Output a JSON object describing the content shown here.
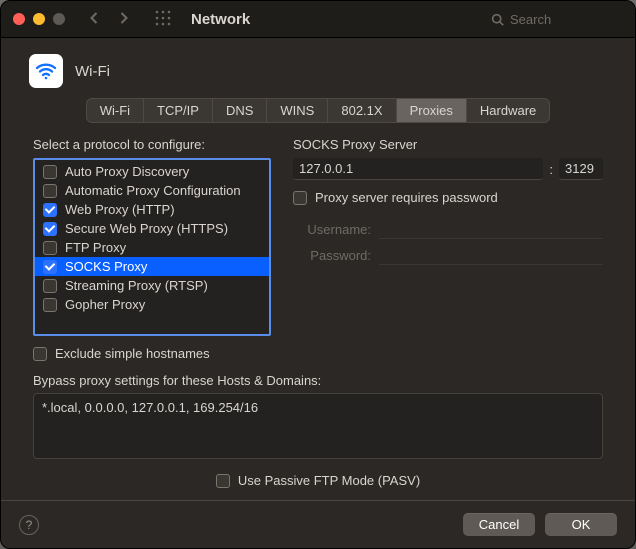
{
  "toolbar": {
    "title": "Network",
    "search_placeholder": "Search"
  },
  "header": {
    "wifi_label": "Wi-Fi"
  },
  "tabs": [
    "Wi-Fi",
    "TCP/IP",
    "DNS",
    "WINS",
    "802.1X",
    "Proxies",
    "Hardware"
  ],
  "active_tab_index": 5,
  "left": {
    "label": "Select a protocol to configure:",
    "protocols": [
      {
        "label": "Auto Proxy Discovery",
        "checked": false,
        "selected": false
      },
      {
        "label": "Automatic Proxy Configuration",
        "checked": false,
        "selected": false
      },
      {
        "label": "Web Proxy (HTTP)",
        "checked": true,
        "selected": false
      },
      {
        "label": "Secure Web Proxy (HTTPS)",
        "checked": true,
        "selected": false
      },
      {
        "label": "FTP Proxy",
        "checked": false,
        "selected": false
      },
      {
        "label": "SOCKS Proxy",
        "checked": true,
        "selected": true
      },
      {
        "label": "Streaming Proxy (RTSP)",
        "checked": false,
        "selected": false
      },
      {
        "label": "Gopher Proxy",
        "checked": false,
        "selected": false
      }
    ]
  },
  "right": {
    "server_label": "SOCKS Proxy Server",
    "host": "127.0.0.1",
    "port": "3129",
    "requires_password_label": "Proxy server requires password",
    "requires_password_checked": false,
    "username_label": "Username:",
    "password_label": "Password:",
    "username_value": "",
    "password_value": ""
  },
  "exclude": {
    "checked": false,
    "label": "Exclude simple hostnames"
  },
  "bypass": {
    "label": "Bypass proxy settings for these Hosts & Domains:",
    "value": "*.local, 0.0.0.0, 127.0.0.1, 169.254/16"
  },
  "pasv": {
    "checked": false,
    "label": "Use Passive FTP Mode (PASV)"
  },
  "footer": {
    "cancel": "Cancel",
    "ok": "OK"
  }
}
